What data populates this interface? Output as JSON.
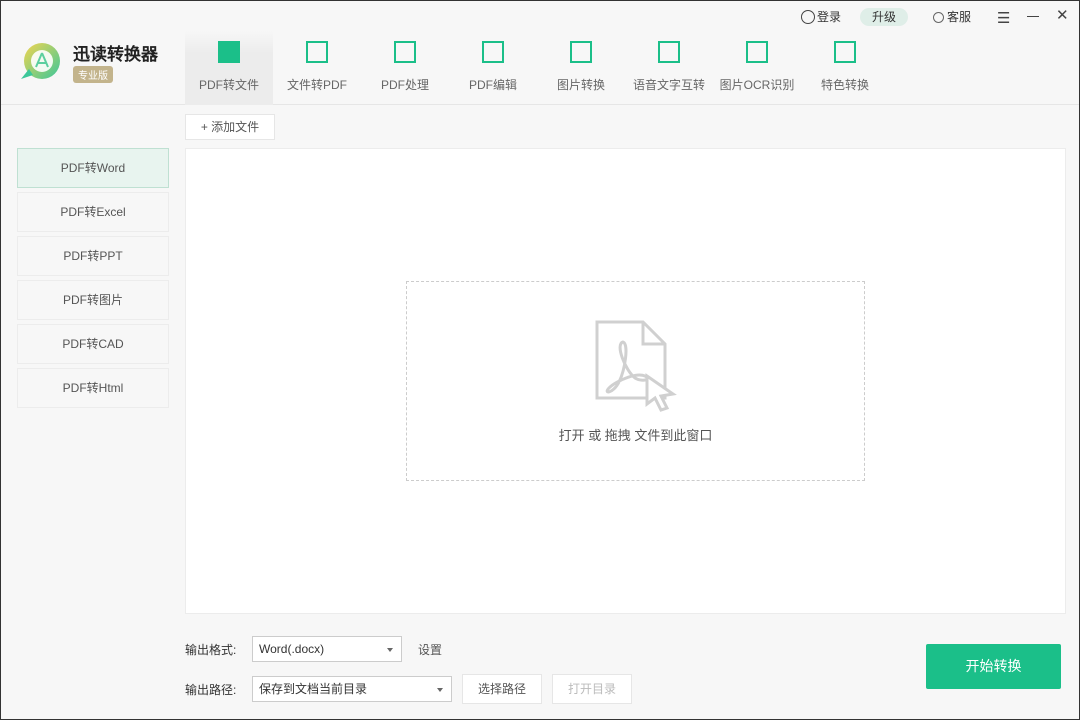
{
  "app": {
    "name": "迅读转换器",
    "edition": "专业版"
  },
  "topbar": {
    "login": "登录",
    "upgrade": "升级",
    "service": "客服"
  },
  "tabs": [
    {
      "label": "PDF转文件",
      "icon": "pdf-to-file-icon"
    },
    {
      "label": "文件转PDF",
      "icon": "file-to-pdf-icon"
    },
    {
      "label": "PDF处理",
      "icon": "pdf-process-icon"
    },
    {
      "label": "PDF编辑",
      "icon": "pdf-edit-icon"
    },
    {
      "label": "图片转换",
      "icon": "image-convert-icon"
    },
    {
      "label": "语音文字互转",
      "icon": "speech-text-icon"
    },
    {
      "label": "图片OCR识别",
      "icon": "ocr-icon"
    },
    {
      "label": "特色转换",
      "icon": "special-convert-icon"
    }
  ],
  "active_tab": 0,
  "sidebar": [
    "PDF转Word",
    "PDF转Excel",
    "PDF转PPT",
    "PDF转图片",
    "PDF转CAD",
    "PDF转Html"
  ],
  "add_file": "+ 添加文件",
  "drop_text": "打开 或 拖拽 文件到此窗口",
  "output": {
    "format_label": "输出格式:",
    "format_value": "Word(.docx)",
    "settings": "设置",
    "path_label": "输出路径:",
    "path_value": "保存到文档当前目录",
    "choose_path": "选择路径",
    "open_dir": "打开目录"
  },
  "start": "开始转换",
  "colors": {
    "accent": "#1bbf89"
  }
}
